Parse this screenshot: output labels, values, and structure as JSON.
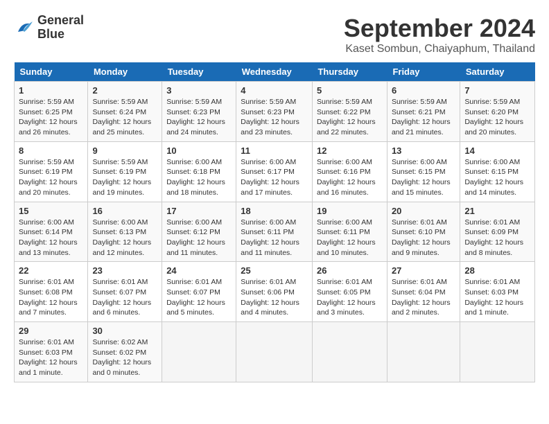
{
  "logo": {
    "line1": "General",
    "line2": "Blue"
  },
  "title": "September 2024",
  "subtitle": "Kaset Sombun, Chaiyaphum, Thailand",
  "days_of_week": [
    "Sunday",
    "Monday",
    "Tuesday",
    "Wednesday",
    "Thursday",
    "Friday",
    "Saturday"
  ],
  "weeks": [
    [
      {
        "day": "1",
        "sunrise": "5:59 AM",
        "sunset": "6:25 PM",
        "daylight": "12 hours and 26 minutes."
      },
      {
        "day": "2",
        "sunrise": "5:59 AM",
        "sunset": "6:24 PM",
        "daylight": "12 hours and 25 minutes."
      },
      {
        "day": "3",
        "sunrise": "5:59 AM",
        "sunset": "6:23 PM",
        "daylight": "12 hours and 24 minutes."
      },
      {
        "day": "4",
        "sunrise": "5:59 AM",
        "sunset": "6:23 PM",
        "daylight": "12 hours and 23 minutes."
      },
      {
        "day": "5",
        "sunrise": "5:59 AM",
        "sunset": "6:22 PM",
        "daylight": "12 hours and 22 minutes."
      },
      {
        "day": "6",
        "sunrise": "5:59 AM",
        "sunset": "6:21 PM",
        "daylight": "12 hours and 21 minutes."
      },
      {
        "day": "7",
        "sunrise": "5:59 AM",
        "sunset": "6:20 PM",
        "daylight": "12 hours and 20 minutes."
      }
    ],
    [
      {
        "day": "8",
        "sunrise": "5:59 AM",
        "sunset": "6:19 PM",
        "daylight": "12 hours and 20 minutes."
      },
      {
        "day": "9",
        "sunrise": "5:59 AM",
        "sunset": "6:19 PM",
        "daylight": "12 hours and 19 minutes."
      },
      {
        "day": "10",
        "sunrise": "6:00 AM",
        "sunset": "6:18 PM",
        "daylight": "12 hours and 18 minutes."
      },
      {
        "day": "11",
        "sunrise": "6:00 AM",
        "sunset": "6:17 PM",
        "daylight": "12 hours and 17 minutes."
      },
      {
        "day": "12",
        "sunrise": "6:00 AM",
        "sunset": "6:16 PM",
        "daylight": "12 hours and 16 minutes."
      },
      {
        "day": "13",
        "sunrise": "6:00 AM",
        "sunset": "6:15 PM",
        "daylight": "12 hours and 15 minutes."
      },
      {
        "day": "14",
        "sunrise": "6:00 AM",
        "sunset": "6:15 PM",
        "daylight": "12 hours and 14 minutes."
      }
    ],
    [
      {
        "day": "15",
        "sunrise": "6:00 AM",
        "sunset": "6:14 PM",
        "daylight": "12 hours and 13 minutes."
      },
      {
        "day": "16",
        "sunrise": "6:00 AM",
        "sunset": "6:13 PM",
        "daylight": "12 hours and 12 minutes."
      },
      {
        "day": "17",
        "sunrise": "6:00 AM",
        "sunset": "6:12 PM",
        "daylight": "12 hours and 11 minutes."
      },
      {
        "day": "18",
        "sunrise": "6:00 AM",
        "sunset": "6:11 PM",
        "daylight": "12 hours and 11 minutes."
      },
      {
        "day": "19",
        "sunrise": "6:00 AM",
        "sunset": "6:11 PM",
        "daylight": "12 hours and 10 minutes."
      },
      {
        "day": "20",
        "sunrise": "6:01 AM",
        "sunset": "6:10 PM",
        "daylight": "12 hours and 9 minutes."
      },
      {
        "day": "21",
        "sunrise": "6:01 AM",
        "sunset": "6:09 PM",
        "daylight": "12 hours and 8 minutes."
      }
    ],
    [
      {
        "day": "22",
        "sunrise": "6:01 AM",
        "sunset": "6:08 PM",
        "daylight": "12 hours and 7 minutes."
      },
      {
        "day": "23",
        "sunrise": "6:01 AM",
        "sunset": "6:07 PM",
        "daylight": "12 hours and 6 minutes."
      },
      {
        "day": "24",
        "sunrise": "6:01 AM",
        "sunset": "6:07 PM",
        "daylight": "12 hours and 5 minutes."
      },
      {
        "day": "25",
        "sunrise": "6:01 AM",
        "sunset": "6:06 PM",
        "daylight": "12 hours and 4 minutes."
      },
      {
        "day": "26",
        "sunrise": "6:01 AM",
        "sunset": "6:05 PM",
        "daylight": "12 hours and 3 minutes."
      },
      {
        "day": "27",
        "sunrise": "6:01 AM",
        "sunset": "6:04 PM",
        "daylight": "12 hours and 2 minutes."
      },
      {
        "day": "28",
        "sunrise": "6:01 AM",
        "sunset": "6:03 PM",
        "daylight": "12 hours and 1 minute."
      }
    ],
    [
      {
        "day": "29",
        "sunrise": "6:01 AM",
        "sunset": "6:03 PM",
        "daylight": "12 hours and 1 minute."
      },
      {
        "day": "30",
        "sunrise": "6:02 AM",
        "sunset": "6:02 PM",
        "daylight": "12 hours and 0 minutes."
      },
      null,
      null,
      null,
      null,
      null
    ]
  ]
}
